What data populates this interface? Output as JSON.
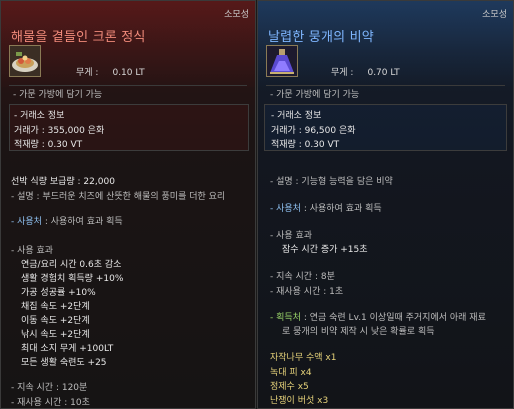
{
  "left": {
    "grade": "소모성",
    "title": "해물을 곁들인 크론 정식",
    "weight_label": "무게 :",
    "weight_value": "0.10 LT",
    "bag": "- 가문 가방에 담기 가능",
    "market_title": "- 거래소 정보",
    "market_price": "거래가 : 355,000 은화",
    "market_load": "적재량 : 0.30 VT",
    "ship_supply": "선박 식량 보급량 : 22,000",
    "desc": "- 설명 : 부드러운 치즈에 산뜻한 해물의 풍미를 더한 요리",
    "usage_label": "- 사용처",
    "usage_text": " : 사용하여 효과 획득",
    "effect_title": "- 사용 효과",
    "effects": [
      "연금/요리 시간 0.6초 감소",
      "생활 경험치 획득량 +10%",
      "가공 성공률 +10%",
      "채집 속도 +2단계",
      "이동 속도 +2단계",
      "낚시 속도 +2단계",
      "최대 소지 무게 +100LT",
      "모든 생활 숙련도 +25"
    ],
    "duration": "- 지속 시간 : 120분",
    "reuse": "- 재사용 시간 : 10초"
  },
  "right": {
    "grade": "소모성",
    "title": "날렵한 뭉개의 비약",
    "weight_label": "무게 :",
    "weight_value": "0.70 LT",
    "bag": "- 가문 가방에 담기 가능",
    "market_title": "- 거래소 정보",
    "market_price": "거래가 : 96,500 은화",
    "market_load": "적재량 : 0.30 VT",
    "desc": "- 설명 : 기능형 능력을 담은 비약",
    "usage_label": "- 사용처",
    "usage_text": " : 사용하여 효과 획득",
    "effect_title": "- 사용 효과",
    "effect_line": "잠수 시간 증가 +15초",
    "duration": "- 지속 시간 : 8분",
    "reuse": "- 재사용 시간 : 1초",
    "obtain_label": "- 획득처",
    "obtain_text": " : 연금 숙련 Lv.1 이상일때 주거지에서 아래 재료",
    "obtain_text2": "로 뭉개의 비약 제작 시 낮은 확률로 획득",
    "materials": [
      "자작나무 수액 x1",
      "녹대 피 x4",
      "정제수 x5",
      "난쟁이 버섯 x3"
    ]
  }
}
